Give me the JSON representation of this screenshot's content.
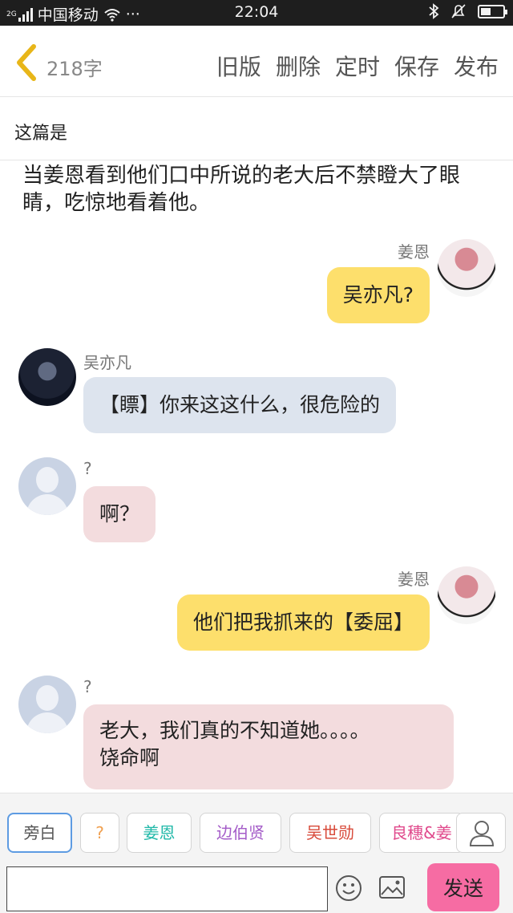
{
  "status_bar": {
    "carrier": "中国移动",
    "network": "2G",
    "more": "···",
    "time": "22:04",
    "battery_level": 0.45
  },
  "header": {
    "word_count": "218字",
    "actions": [
      "旧版",
      "删除",
      "定时",
      "保存",
      "发布"
    ]
  },
  "title": "这篇是",
  "narration": "当姜恩看到他们口中所说的老大后不禁瞪大了眼睛，吃惊地看着他。",
  "messages": [
    {
      "side": "right",
      "name": "姜恩",
      "text": "吴亦凡?"
    },
    {
      "side": "left",
      "name": "吴亦凡",
      "text": "【瞟】你来这这什么，很危险的"
    },
    {
      "side": "left",
      "name": "?",
      "text": "啊？"
    },
    {
      "side": "right",
      "name": "姜恩",
      "text": "他们把我抓来的【委屈】"
    },
    {
      "side": "left",
      "name": "?",
      "text_line1": "老大，我们真的不知道她。。。。",
      "text_line2": "饶命啊"
    }
  ],
  "roles": [
    {
      "label": "旁白",
      "color": "#555555"
    },
    {
      "label": "?",
      "color": "#f0a050"
    },
    {
      "label": "姜恩",
      "color": "#1fb8a8"
    },
    {
      "label": "边伯贤",
      "color": "#a45cc8"
    },
    {
      "label": "吴世勋",
      "color": "#d84a3a"
    },
    {
      "label": "良穗&姜",
      "color": "#e04a8c"
    }
  ],
  "input": {
    "placeholder": "",
    "send_label": "发送"
  },
  "colors": {
    "yellow_bubble": "#fddf6c",
    "blue_bubble": "#dde4ee",
    "pink_bubble": "#f3dcde",
    "send_button": "#f66ca3",
    "back_arrow": "#e8b619"
  }
}
